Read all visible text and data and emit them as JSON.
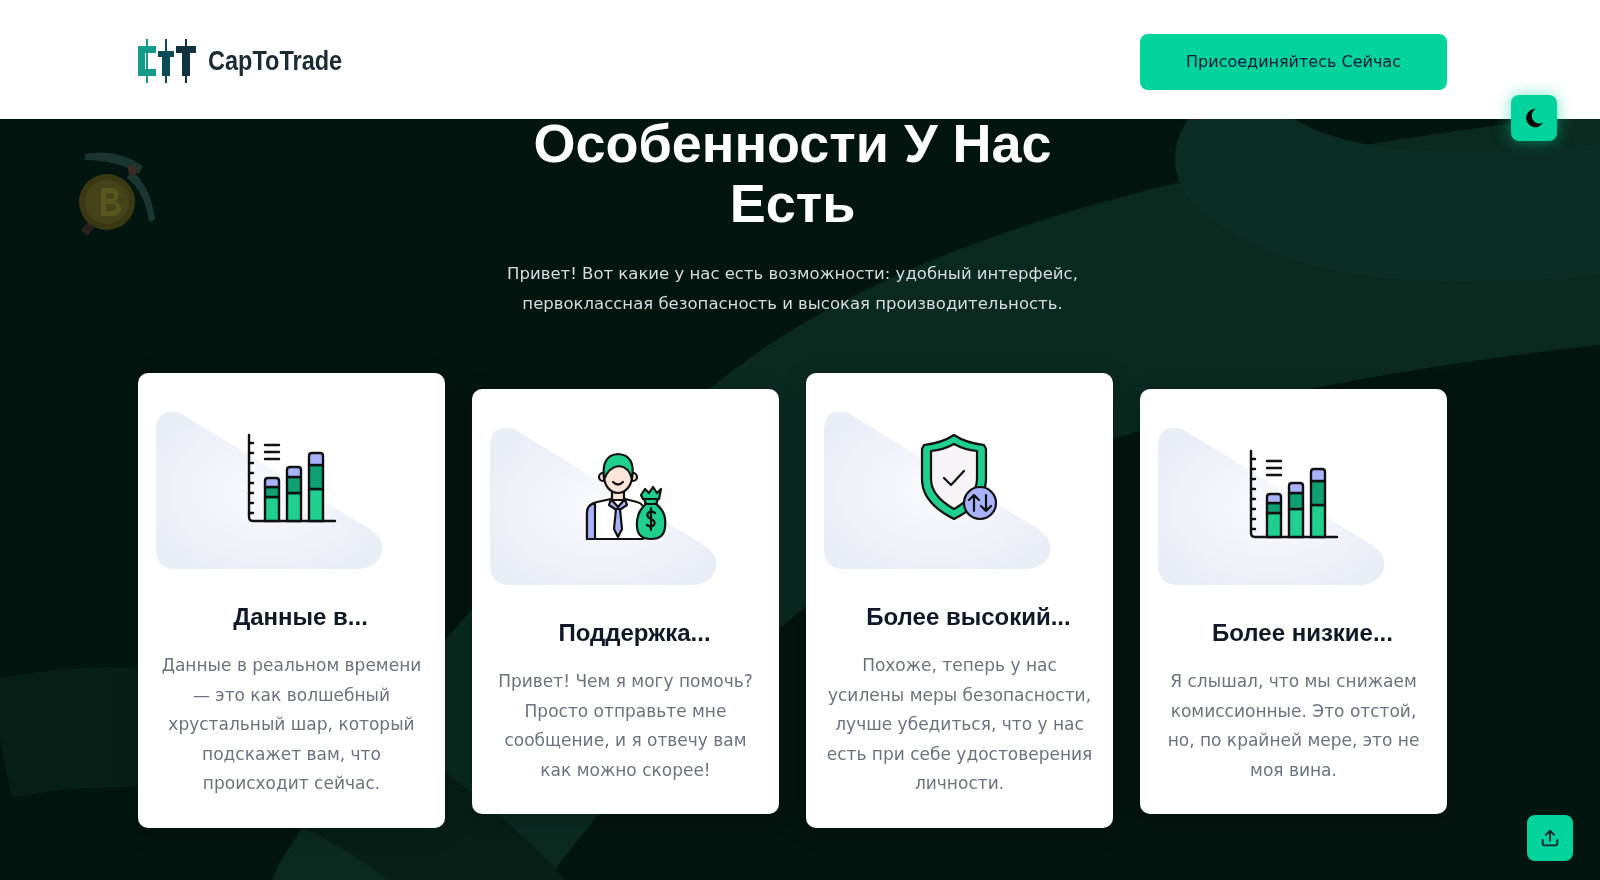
{
  "header": {
    "logo_text": "CapToTrade",
    "join_button": "Присоединяйтесь Сейчас"
  },
  "section": {
    "title": "Особенности У Нас Есть",
    "subtitle": "Привет! Вот какие у нас есть возможности: удобный интерфейс, первоклассная безопасность и высокая производительность."
  },
  "features": [
    {
      "kind": "chart",
      "title": "Данные в...",
      "text": "Данные в реальном времени — это как волшебный хрустальный шар, который подскажет вам, что происходит сейчас."
    },
    {
      "kind": "support",
      "title": "Поддержка...",
      "text": "Привет! Чем я могу помочь? Просто отправьте мне сообщение, и я отвечу вам как можно скорее!"
    },
    {
      "kind": "security",
      "title": "Более высокий...",
      "text": "Похоже, теперь у нас усилены меры безопасности, лучше убедиться, что у нас есть при себе удостоверения личности."
    },
    {
      "kind": "chart",
      "title": "Более низкие...",
      "text": "Я слышал, что мы снижаем комиссионные. Это отстой, но, по крайней мере, это не моя вина."
    }
  ]
}
